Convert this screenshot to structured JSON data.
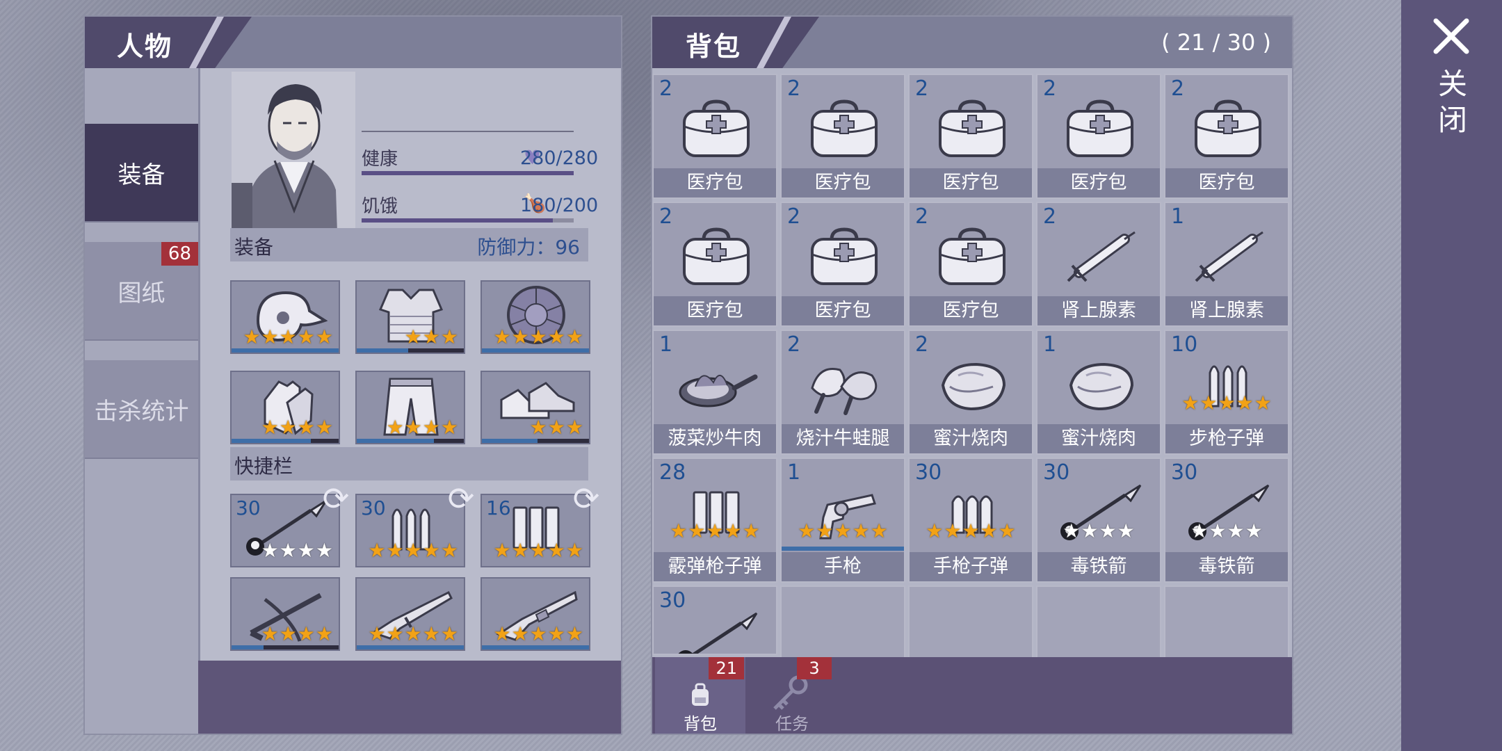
{
  "character_panel": {
    "title": "人物",
    "tabs": [
      {
        "label": "装备"
      },
      {
        "label": "图纸",
        "badge": "68"
      },
      {
        "label": "击杀统计"
      }
    ],
    "stats": {
      "health_label": "健康",
      "health_value": "280/280",
      "health_fill": 1.0,
      "hunger_label": "饥饿",
      "hunger_value": "180/200",
      "hunger_fill": 0.9
    },
    "equipment": {
      "label": "装备",
      "defense": "防御力：96",
      "slots": [
        {
          "icon": "bird-mask-helmet-icon",
          "stars": 5,
          "progress": 1.0
        },
        {
          "icon": "chest-armor-icon",
          "stars": 3,
          "progress": 0.48
        },
        {
          "icon": "turtle-shell-icon",
          "stars": 5,
          "progress": 1.0
        },
        {
          "icon": "gloves-icon",
          "stars": 4,
          "progress": 0.74
        },
        {
          "icon": "pants-icon",
          "stars": 4,
          "progress": 0.72
        },
        {
          "icon": "sneakers-icon",
          "stars": 3,
          "progress": 0.52
        }
      ]
    },
    "quickbar": {
      "label": "快捷栏",
      "slots": [
        {
          "count": "30",
          "icon": "poison-arrow-icon",
          "stars": 4,
          "white_stars": true
        },
        {
          "count": "30",
          "icon": "rifle-ammo-icon",
          "stars": 5
        },
        {
          "count": "16",
          "icon": "shotgun-shells-icon",
          "stars": 5
        },
        {
          "count": "",
          "icon": "crossbow-icon",
          "stars": 4,
          "progress": 0.3
        },
        {
          "count": "",
          "icon": "rifle-icon",
          "stars": 5,
          "progress": 1.0
        },
        {
          "count": "",
          "icon": "shotgun-icon",
          "stars": 5,
          "progress": 1.0
        }
      ]
    }
  },
  "bag_panel": {
    "title": "背包",
    "capacity": "( 21 / 30 )",
    "items": [
      {
        "count": "2",
        "name": "医疗包",
        "icon": "medkit-icon"
      },
      {
        "count": "2",
        "name": "医疗包",
        "icon": "medkit-icon"
      },
      {
        "count": "2",
        "name": "医疗包",
        "icon": "medkit-icon"
      },
      {
        "count": "2",
        "name": "医疗包",
        "icon": "medkit-icon"
      },
      {
        "count": "2",
        "name": "医疗包",
        "icon": "medkit-icon"
      },
      {
        "count": "2",
        "name": "医疗包",
        "icon": "medkit-icon"
      },
      {
        "count": "2",
        "name": "医疗包",
        "icon": "medkit-icon"
      },
      {
        "count": "2",
        "name": "医疗包",
        "icon": "medkit-icon"
      },
      {
        "count": "2",
        "name": "肾上腺素",
        "icon": "syringe-icon"
      },
      {
        "count": "1",
        "name": "肾上腺素",
        "icon": "syringe-icon"
      },
      {
        "count": "1",
        "name": "菠菜炒牛肉",
        "icon": "frying-pan-icon"
      },
      {
        "count": "2",
        "name": "烧汁牛蛙腿",
        "icon": "frog-legs-icon"
      },
      {
        "count": "2",
        "name": "蜜汁烧肉",
        "icon": "roast-meat-icon"
      },
      {
        "count": "1",
        "name": "蜜汁烧肉",
        "icon": "roast-meat-icon"
      },
      {
        "count": "10",
        "name": "步枪子弹",
        "icon": "rifle-ammo-icon",
        "stars": 5
      },
      {
        "count": "28",
        "name": "霰弹枪子弹",
        "icon": "shotgun-shells-icon",
        "stars": 5
      },
      {
        "count": "1",
        "name": "手枪",
        "icon": "revolver-icon",
        "stars": 5,
        "progress": 1.0
      },
      {
        "count": "30",
        "name": "手枪子弹",
        "icon": "pistol-ammo-icon",
        "stars": 5
      },
      {
        "count": "30",
        "name": "毒铁箭",
        "icon": "poison-arrow-icon",
        "stars": 4,
        "white_stars": true
      },
      {
        "count": "30",
        "name": "毒铁箭",
        "icon": "poison-arrow-icon",
        "stars": 4,
        "white_stars": true
      },
      {
        "count": "30",
        "name": "",
        "icon": "poison-arrow-icon"
      }
    ],
    "tabs": [
      {
        "label": "背包",
        "badge": "21",
        "icon": "backpack-icon"
      },
      {
        "label": "任务",
        "badge": "3",
        "icon": "key-icon"
      }
    ]
  },
  "close": {
    "label": "关闭",
    "icon": "close-icon"
  },
  "colors": {
    "accent": "#504a6b",
    "badge": "#a3313a",
    "count_text": "#1f4f92",
    "star": "#f2a216"
  }
}
